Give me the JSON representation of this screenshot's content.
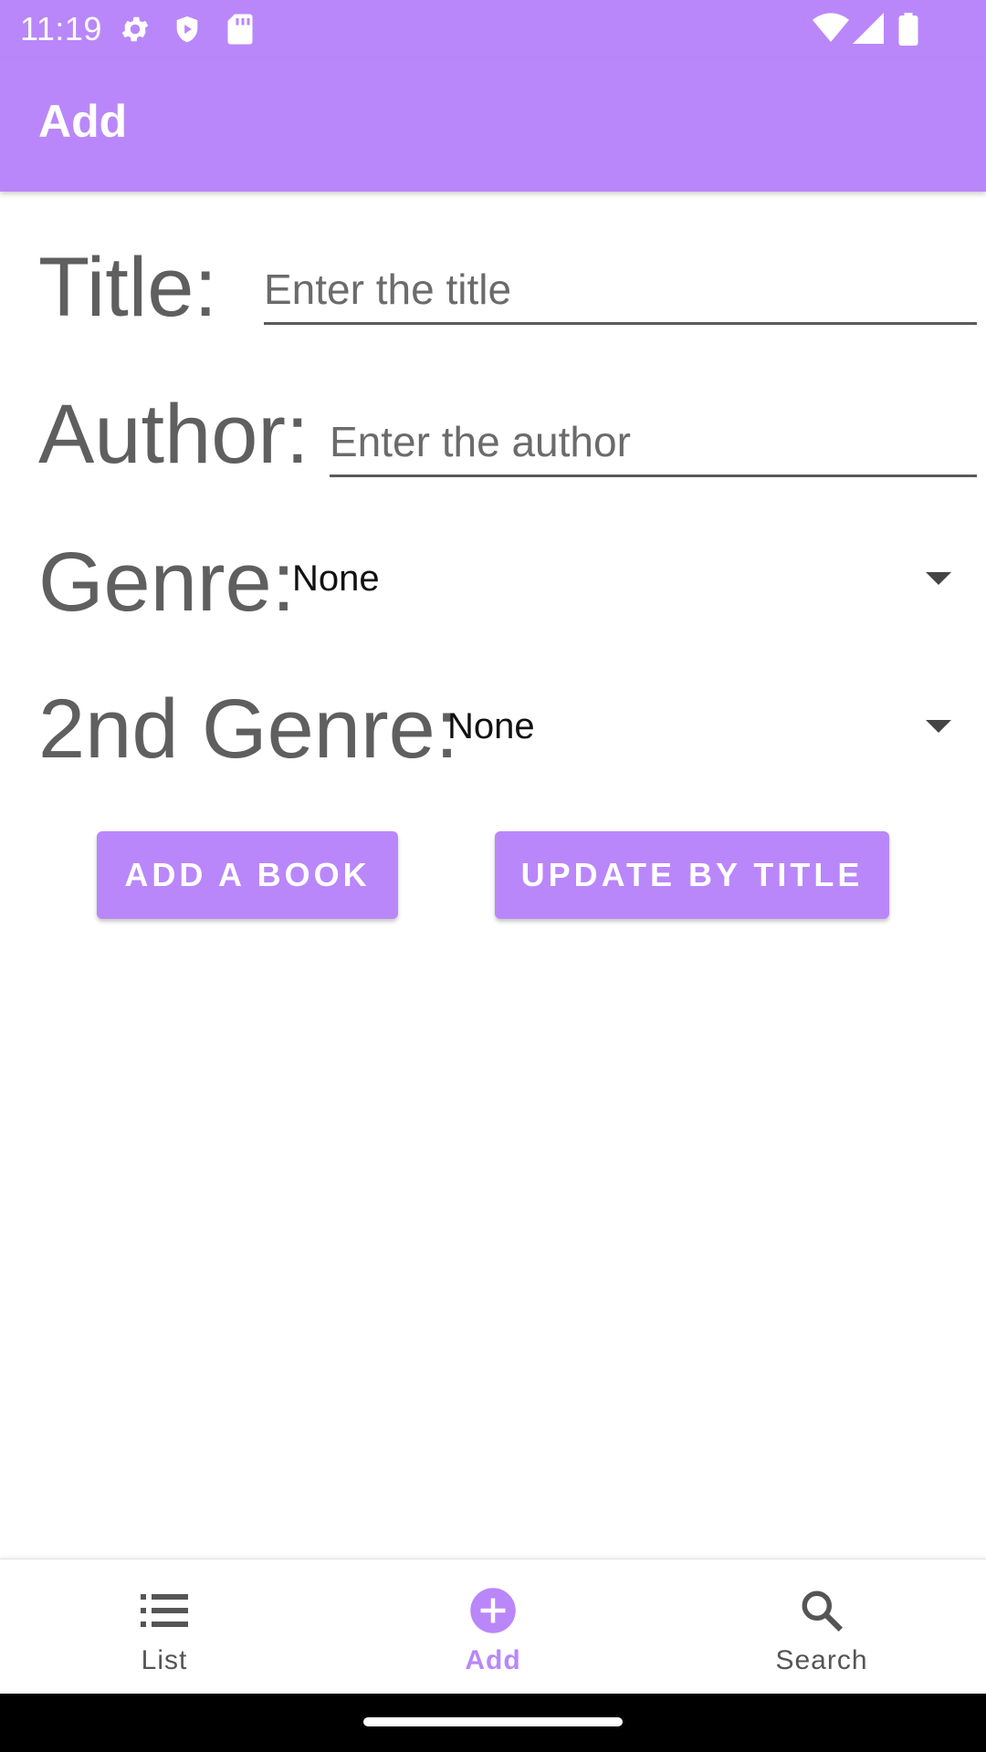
{
  "status_bar": {
    "time": "11:19",
    "icons": [
      "gear-icon",
      "shield-icon",
      "sd-card-icon",
      "wifi-icon",
      "signal-icon",
      "battery-icon"
    ]
  },
  "app_bar": {
    "title": "Add"
  },
  "form": {
    "title": {
      "label": "Title:",
      "placeholder": "Enter the title",
      "value": ""
    },
    "author": {
      "label": "Author:",
      "placeholder": "Enter the author",
      "value": ""
    },
    "genre": {
      "label": "Genre:",
      "selected": "None"
    },
    "second_genre": {
      "label": "2nd Genre:",
      "selected": "None"
    }
  },
  "actions": {
    "add_label": "ADD A BOOK",
    "update_label": "UPDATE BY TITLE"
  },
  "bottom_nav": {
    "items": [
      {
        "label": "List",
        "icon": "list-icon"
      },
      {
        "label": "Add",
        "icon": "add-circle-icon",
        "active": true
      },
      {
        "label": "Search",
        "icon": "search-icon"
      }
    ]
  },
  "colors": {
    "primary": "#b987fa",
    "label_gray": "#5f5f5f",
    "nav_inactive": "#555555"
  }
}
